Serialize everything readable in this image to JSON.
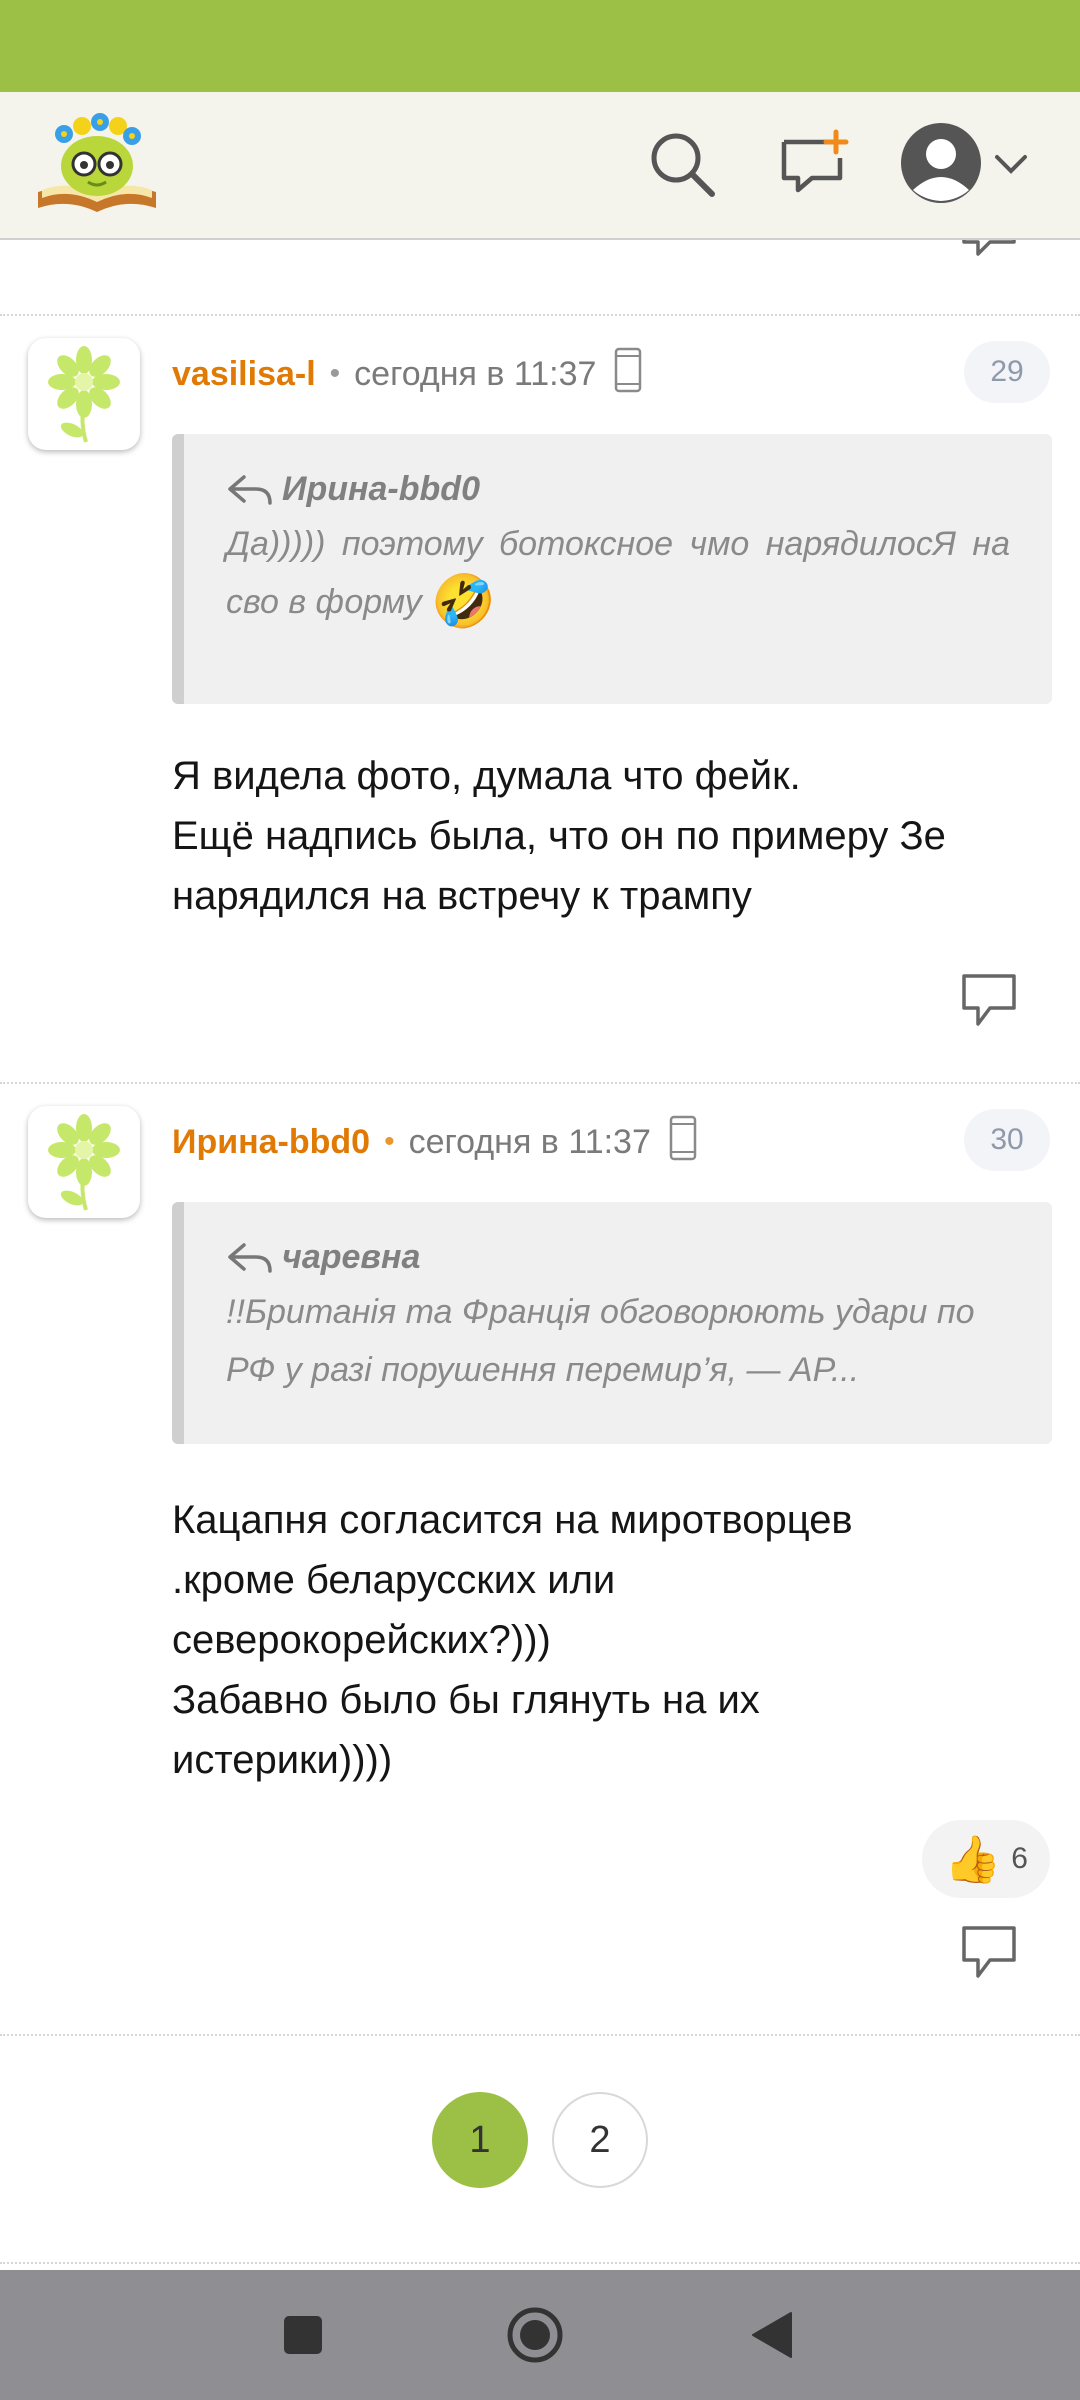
{
  "colors": {
    "accent": "#9cc045",
    "author": "#e07a05",
    "navbar": "#8e8e93"
  },
  "header": {
    "logo_icon": "site-logo-icon",
    "search_icon": "search-icon",
    "new_post_icon": "new-message-icon",
    "profile_icon": "user-avatar-icon",
    "menu_icon": "chevron-down-icon"
  },
  "comments": [
    {
      "author": "vasilisa-l",
      "separator": "•",
      "time": "сегодня в 11:37",
      "number": "29",
      "quote_author": "Ирина-bbd0",
      "quote_text": "Да))))) поэтому ботоксное чмо нарядилосЯ на сво в форму",
      "quote_emoji": "🤣",
      "text": "Я видела фото, думала что фейк.\nЕщё надпись была, что он по примеру Зе нарядился на встречу к трампу"
    },
    {
      "author": "Ирина-bbd0",
      "separator": "•",
      "time": "сегодня в 11:37",
      "number": "30",
      "quote_author": "чаревна",
      "quote_text": "!!Британія та Франція обговорюють удари по РФ у разі порушення перемир’я, — AP...",
      "text": "Кацапня согласится на миротворцев\n.кроме беларусских или\nсеверокорейских?)))\nЗабавно было бы глянуть на их\nистерики))))",
      "likes": "6",
      "like_emoji": "👍"
    }
  ],
  "pagination": {
    "pages": [
      "1",
      "2"
    ],
    "current": "1"
  }
}
